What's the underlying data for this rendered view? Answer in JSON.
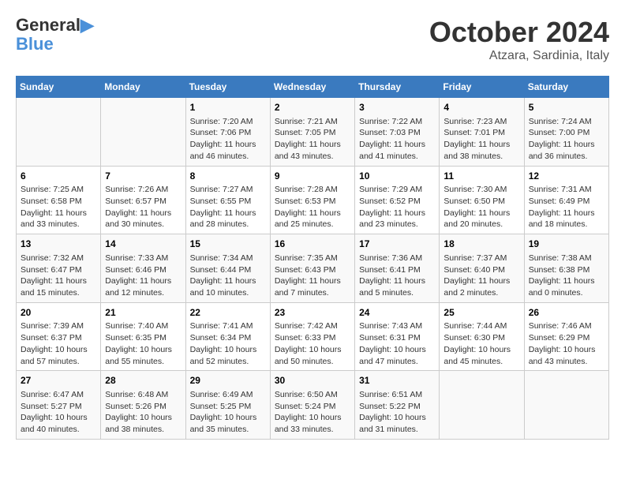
{
  "logo": {
    "line1": "General",
    "line2": "Blue"
  },
  "title": "October 2024",
  "subtitle": "Atzara, Sardinia, Italy",
  "days_of_week": [
    "Sunday",
    "Monday",
    "Tuesday",
    "Wednesday",
    "Thursday",
    "Friday",
    "Saturday"
  ],
  "weeks": [
    [
      {
        "day": "",
        "info": ""
      },
      {
        "day": "",
        "info": ""
      },
      {
        "day": "1",
        "info": "Sunrise: 7:20 AM\nSunset: 7:06 PM\nDaylight: 11 hours and 46 minutes."
      },
      {
        "day": "2",
        "info": "Sunrise: 7:21 AM\nSunset: 7:05 PM\nDaylight: 11 hours and 43 minutes."
      },
      {
        "day": "3",
        "info": "Sunrise: 7:22 AM\nSunset: 7:03 PM\nDaylight: 11 hours and 41 minutes."
      },
      {
        "day": "4",
        "info": "Sunrise: 7:23 AM\nSunset: 7:01 PM\nDaylight: 11 hours and 38 minutes."
      },
      {
        "day": "5",
        "info": "Sunrise: 7:24 AM\nSunset: 7:00 PM\nDaylight: 11 hours and 36 minutes."
      }
    ],
    [
      {
        "day": "6",
        "info": "Sunrise: 7:25 AM\nSunset: 6:58 PM\nDaylight: 11 hours and 33 minutes."
      },
      {
        "day": "7",
        "info": "Sunrise: 7:26 AM\nSunset: 6:57 PM\nDaylight: 11 hours and 30 minutes."
      },
      {
        "day": "8",
        "info": "Sunrise: 7:27 AM\nSunset: 6:55 PM\nDaylight: 11 hours and 28 minutes."
      },
      {
        "day": "9",
        "info": "Sunrise: 7:28 AM\nSunset: 6:53 PM\nDaylight: 11 hours and 25 minutes."
      },
      {
        "day": "10",
        "info": "Sunrise: 7:29 AM\nSunset: 6:52 PM\nDaylight: 11 hours and 23 minutes."
      },
      {
        "day": "11",
        "info": "Sunrise: 7:30 AM\nSunset: 6:50 PM\nDaylight: 11 hours and 20 minutes."
      },
      {
        "day": "12",
        "info": "Sunrise: 7:31 AM\nSunset: 6:49 PM\nDaylight: 11 hours and 18 minutes."
      }
    ],
    [
      {
        "day": "13",
        "info": "Sunrise: 7:32 AM\nSunset: 6:47 PM\nDaylight: 11 hours and 15 minutes."
      },
      {
        "day": "14",
        "info": "Sunrise: 7:33 AM\nSunset: 6:46 PM\nDaylight: 11 hours and 12 minutes."
      },
      {
        "day": "15",
        "info": "Sunrise: 7:34 AM\nSunset: 6:44 PM\nDaylight: 11 hours and 10 minutes."
      },
      {
        "day": "16",
        "info": "Sunrise: 7:35 AM\nSunset: 6:43 PM\nDaylight: 11 hours and 7 minutes."
      },
      {
        "day": "17",
        "info": "Sunrise: 7:36 AM\nSunset: 6:41 PM\nDaylight: 11 hours and 5 minutes."
      },
      {
        "day": "18",
        "info": "Sunrise: 7:37 AM\nSunset: 6:40 PM\nDaylight: 11 hours and 2 minutes."
      },
      {
        "day": "19",
        "info": "Sunrise: 7:38 AM\nSunset: 6:38 PM\nDaylight: 11 hours and 0 minutes."
      }
    ],
    [
      {
        "day": "20",
        "info": "Sunrise: 7:39 AM\nSunset: 6:37 PM\nDaylight: 10 hours and 57 minutes."
      },
      {
        "day": "21",
        "info": "Sunrise: 7:40 AM\nSunset: 6:35 PM\nDaylight: 10 hours and 55 minutes."
      },
      {
        "day": "22",
        "info": "Sunrise: 7:41 AM\nSunset: 6:34 PM\nDaylight: 10 hours and 52 minutes."
      },
      {
        "day": "23",
        "info": "Sunrise: 7:42 AM\nSunset: 6:33 PM\nDaylight: 10 hours and 50 minutes."
      },
      {
        "day": "24",
        "info": "Sunrise: 7:43 AM\nSunset: 6:31 PM\nDaylight: 10 hours and 47 minutes."
      },
      {
        "day": "25",
        "info": "Sunrise: 7:44 AM\nSunset: 6:30 PM\nDaylight: 10 hours and 45 minutes."
      },
      {
        "day": "26",
        "info": "Sunrise: 7:46 AM\nSunset: 6:29 PM\nDaylight: 10 hours and 43 minutes."
      }
    ],
    [
      {
        "day": "27",
        "info": "Sunrise: 6:47 AM\nSunset: 5:27 PM\nDaylight: 10 hours and 40 minutes."
      },
      {
        "day": "28",
        "info": "Sunrise: 6:48 AM\nSunset: 5:26 PM\nDaylight: 10 hours and 38 minutes."
      },
      {
        "day": "29",
        "info": "Sunrise: 6:49 AM\nSunset: 5:25 PM\nDaylight: 10 hours and 35 minutes."
      },
      {
        "day": "30",
        "info": "Sunrise: 6:50 AM\nSunset: 5:24 PM\nDaylight: 10 hours and 33 minutes."
      },
      {
        "day": "31",
        "info": "Sunrise: 6:51 AM\nSunset: 5:22 PM\nDaylight: 10 hours and 31 minutes."
      },
      {
        "day": "",
        "info": ""
      },
      {
        "day": "",
        "info": ""
      }
    ]
  ]
}
